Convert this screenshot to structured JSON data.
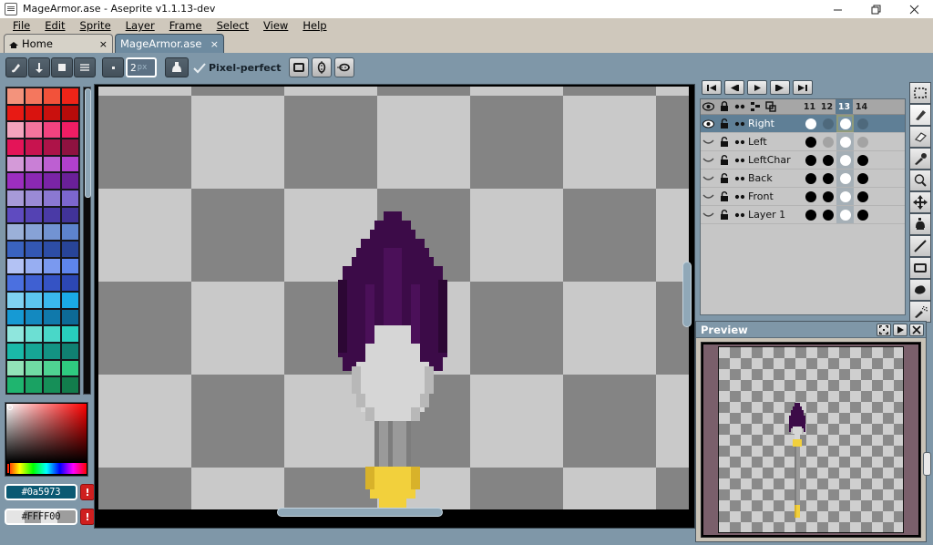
{
  "window": {
    "title": "MageArmor.ase - Aseprite v1.1.13-dev",
    "app_icon": "aseprite-icon",
    "controls": {
      "minimize": "minimize-icon",
      "maximize": "maximize-icon",
      "close": "close-icon"
    }
  },
  "menubar": {
    "items": [
      {
        "label": "File"
      },
      {
        "label": "Edit"
      },
      {
        "label": "Sprite"
      },
      {
        "label": "Layer"
      },
      {
        "label": "Frame"
      },
      {
        "label": "Select"
      },
      {
        "label": "View"
      },
      {
        "label": "Help"
      }
    ]
  },
  "tabs": [
    {
      "label": "Home",
      "icon": "home-icon",
      "close": "×",
      "active": false
    },
    {
      "label": "MageArmor.ase",
      "close": "×",
      "active": true
    }
  ],
  "toolbar": {
    "buttons": [
      {
        "name": "brush-preset-button",
        "icon": "pencil-icon"
      },
      {
        "name": "brush-down-button",
        "icon": "arrow-down-icon"
      },
      {
        "name": "brush-square-button",
        "icon": "square-icon"
      },
      {
        "name": "brush-lines-button",
        "icon": "lines-icon"
      },
      {
        "name": "brush-dot-button",
        "icon": "dot-icon"
      }
    ],
    "brush_size": {
      "value": "2",
      "unit": "px",
      "placeholder": "2"
    },
    "ink_button": {
      "name": "ink-type-button",
      "icon": "ink-bottle-icon"
    },
    "pixel_perfect": {
      "label": "Pixel-perfect",
      "checked": true,
      "icon": "check-icon"
    },
    "symmetry": [
      {
        "name": "symmetry-none-button",
        "icon": "rect-icon"
      },
      {
        "name": "symmetry-vertical-button",
        "icon": "vertical-symmetry-icon"
      },
      {
        "name": "symmetry-horizontal-button",
        "icon": "horizontal-symmetry-icon"
      }
    ]
  },
  "palette": {
    "scrollbar": "palette-scrollbar",
    "colors": [
      "#f3937c",
      "#f4775e",
      "#f2523a",
      "#ef2418",
      "#e81a14",
      "#d9130f",
      "#c9100d",
      "#b60b0a",
      "#f4a4bd",
      "#f4749d",
      "#f2437f",
      "#ef1d64",
      "#e41458",
      "#c8134f",
      "#ad1348",
      "#8e1240",
      "#d49ad8",
      "#c97fd6",
      "#bd5fd2",
      "#b140cd",
      "#9c2ec0",
      "#8b28b3",
      "#7a24a6",
      "#6a2098",
      "#a79ad8",
      "#9a8ad6",
      "#8b78d2",
      "#7c66cd",
      "#5f4bc0",
      "#5442b3",
      "#4a3aa6",
      "#413398",
      "#9bb0d8",
      "#87a2d6",
      "#7293d2",
      "#5d83cd",
      "#3a63c0",
      "#3357b3",
      "#2d4da6",
      "#284498",
      "#b3c2f4",
      "#97aef2",
      "#7a99ef",
      "#5e85ec",
      "#4b70e0",
      "#3f60d2",
      "#3553c4",
      "#2c47b3",
      "#7fd2f2",
      "#5cc6ef",
      "#3ab8ec",
      "#1aaae6",
      "#169ad4",
      "#1389c0",
      "#1079ab",
      "#0d6a96",
      "#8fe6dd",
      "#6cdfd3",
      "#49d7c8",
      "#28cebd",
      "#1ab9a8",
      "#16a695",
      "#139383",
      "#108071",
      "#92e3b8",
      "#70dba4",
      "#4fd392",
      "#2fca80",
      "#1fb56f",
      "#1aa263",
      "#168f58",
      "#127c4c"
    ]
  },
  "color_picker": {
    "sv_area": "saturation-value-area",
    "hue_slider": "hue-slider",
    "foreground": {
      "hex": "#0a5973",
      "text": "#0a5973",
      "warn": "!"
    },
    "background": {
      "hex": "#FFFF00",
      "text": "#FFFF00",
      "warn": "!"
    }
  },
  "canvas": {
    "checker_light": "#c9c9c9",
    "checker_dark": "#848484",
    "horizontal_scrollbar": "canvas-h-scrollbar",
    "vertical_scrollbar": "canvas-v-scrollbar",
    "sprite_colors": {
      "hood_dark": "#3c0b48",
      "hood_mid": "#4b1059",
      "face_light": "#d6d6d6",
      "face_mid": "#b8b8b8",
      "shaft": "#9a9a9a",
      "shaft_dark": "#7d7d7d",
      "gem": "#f2d03c",
      "gem_dark": "#d8b22a"
    }
  },
  "timeline": {
    "playback": [
      {
        "name": "goto-first-frame-button",
        "icon": "skip-back-icon"
      },
      {
        "name": "previous-frame-button",
        "icon": "step-back-icon"
      },
      {
        "name": "play-button",
        "icon": "play-icon"
      },
      {
        "name": "next-frame-button",
        "icon": "step-forward-icon"
      },
      {
        "name": "goto-last-frame-button",
        "icon": "skip-forward-icon"
      }
    ],
    "header_icons": [
      {
        "name": "eye-column-icon",
        "icon": "eye-icon"
      },
      {
        "name": "lock-column-icon",
        "icon": "padlock-icon"
      },
      {
        "name": "link-column-icon",
        "icon": "link-icon"
      },
      {
        "name": "onion-skin-icon",
        "icon": "onion-skin-icon"
      },
      {
        "name": "layer-group-icon",
        "icon": "frames-icon"
      }
    ],
    "frames": [
      "11",
      "12",
      "13",
      "14"
    ],
    "current_frame": "13",
    "layers": [
      {
        "name": "Right",
        "visible": true,
        "locked": false,
        "selected": true,
        "cells": [
          "white",
          "empty",
          "white",
          "empty"
        ],
        "active_cell_index": 2
      },
      {
        "name": "Left",
        "visible": false,
        "locked": false,
        "selected": false,
        "cells": [
          "black",
          "empty",
          "white",
          "empty"
        ]
      },
      {
        "name": "LeftChar",
        "visible": false,
        "locked": false,
        "selected": false,
        "cells": [
          "black",
          "black",
          "white",
          "black"
        ]
      },
      {
        "name": "Back",
        "visible": false,
        "locked": false,
        "selected": false,
        "cells": [
          "black",
          "black",
          "white",
          "black"
        ]
      },
      {
        "name": "Front",
        "visible": false,
        "locked": false,
        "selected": false,
        "cells": [
          "black",
          "black",
          "white",
          "black"
        ]
      },
      {
        "name": "Layer 1",
        "visible": false,
        "locked": false,
        "selected": false,
        "cells": [
          "black",
          "black",
          "white",
          "black"
        ]
      }
    ]
  },
  "tools": [
    {
      "name": "marquee-tool",
      "icon": "marquee-icon",
      "selected": false
    },
    {
      "name": "pencil-tool",
      "icon": "pencil-icon",
      "selected": true
    },
    {
      "name": "eraser-tool",
      "icon": "eraser-icon",
      "selected": false
    },
    {
      "name": "eyedropper-tool",
      "icon": "eyedropper-icon",
      "selected": false
    },
    {
      "name": "zoom-tool",
      "icon": "magnifier-icon",
      "selected": false
    },
    {
      "name": "move-tool",
      "icon": "move-arrows-icon",
      "selected": false
    },
    {
      "name": "paint-bucket-tool",
      "icon": "paint-bucket-icon",
      "selected": false
    },
    {
      "name": "line-tool",
      "icon": "line-icon",
      "selected": false
    },
    {
      "name": "rectangle-tool",
      "icon": "rectangle-icon",
      "selected": false
    },
    {
      "name": "contour-tool",
      "icon": "blob-icon",
      "selected": false
    },
    {
      "name": "spray-tool",
      "icon": "spray-icon",
      "selected": false
    }
  ],
  "preview": {
    "title": "Preview",
    "buttons": [
      {
        "name": "fit-screen-button",
        "icon": "fit-screen-icon"
      },
      {
        "name": "play-preview-button",
        "icon": "play-icon"
      },
      {
        "name": "close-preview-button",
        "icon": "close-icon"
      }
    ],
    "scrollbar": "preview-v-scrollbar"
  }
}
